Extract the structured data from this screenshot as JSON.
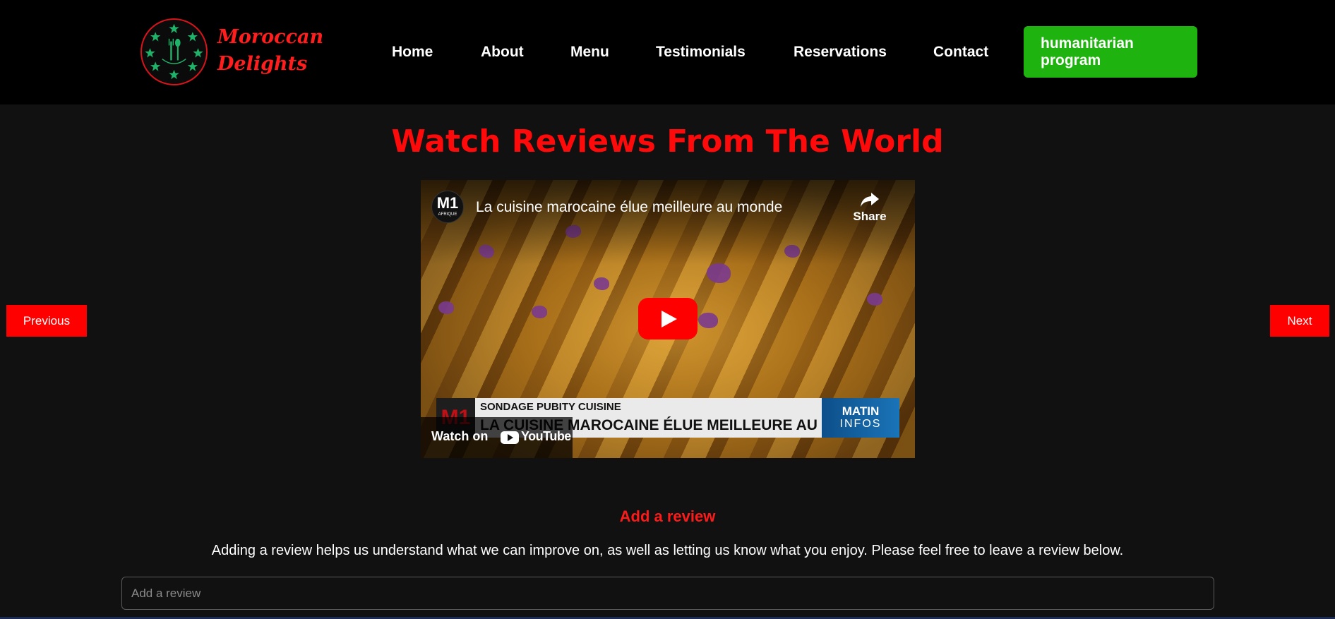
{
  "header": {
    "brand_line1": "Moroccan",
    "brand_line2": "Delights",
    "nav": [
      "Home",
      "About",
      "Menu",
      "Testimonials",
      "Reservations",
      "Contact"
    ],
    "cta_label": "humanitarian program",
    "logo_icon": "fork-spoon-stars-emblem-icon",
    "colors": {
      "brand": "#ff1d1d",
      "cta": "#1fb30f",
      "logo_stars": "#1fb36a"
    }
  },
  "section": {
    "title": "Watch Reviews From The World",
    "title_color": "#ff0a0a"
  },
  "video": {
    "channel_logo": "M1",
    "channel_logo_sub": "AFRIQUE",
    "title": "La cuisine marocaine élue meilleure au monde",
    "share_label": "Share",
    "banner_logo": "M1",
    "banner_kicker": "SONDAGE PUBITY CUISINE",
    "banner_headline": "LA CUISINE MAROCAINE ÉLUE MEILLEURE AU MONDE",
    "banner_brand_a": "MATIN",
    "banner_brand_b": "INFOS",
    "watch_on_label": "Watch on",
    "youtube_label": "YouTube"
  },
  "carousel": {
    "previous_label": "Previous",
    "next_label": "Next"
  },
  "review": {
    "heading": "Add a review",
    "description": "Adding a review helps us understand what we can improve on, as well as letting us know what you enjoy. Please feel free to leave a review below.",
    "input_placeholder": "Add a review"
  }
}
